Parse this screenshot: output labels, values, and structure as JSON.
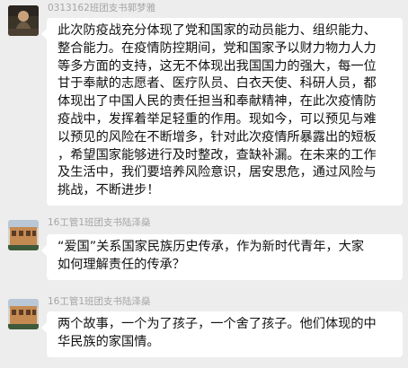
{
  "messages": [
    {
      "sender": "0313162班团支书郭梦雅",
      "avatar": "avatar-dark-photo",
      "lines": [
        "此次防疫战充分体现了党和国家的动员能力、组织能力、",
        "整合能力。在疫情防控期间，党和国家予以财力物力人力",
        "等多方面的支持，这无不体现出我国国力的强大，每一位",
        "甘于奉献的志愿者、医疗队员、白衣天使、科研人员，都",
        "体现出了中国人民的责任担当和奉献精神，在此次疫情防",
        "疫战中，发挥着举足轻重的作用。现如今，可以预见与难",
        "以预见的风险在不断增多，针对此次疫情所暴露出的短板",
        "，希望国家能够进行及时整改，查缺补漏。在未来的工作",
        "及生活中，我们要培养风险意识，居安思危，通过风险与",
        "挑战，不断进步！"
      ]
    },
    {
      "sender": "16工管1班团支书陆泽燊",
      "avatar": "avatar-building-photo",
      "lines": [
        "“爱国”关系国家民族历史传承，作为新时代青年，大家",
        "如何理解责任的传承？"
      ]
    },
    {
      "sender": "16工管1班团支书陆泽燊",
      "avatar": "avatar-building-photo",
      "lines": [
        "两个故事，一个为了孩子，一个舍了孩子。他们体现的中",
        "华民族的家国情。"
      ]
    }
  ],
  "colors": {
    "background": "#ededed",
    "bubble": "#ffffff",
    "sender_name": "#a5a5a5",
    "text": "#111111"
  }
}
